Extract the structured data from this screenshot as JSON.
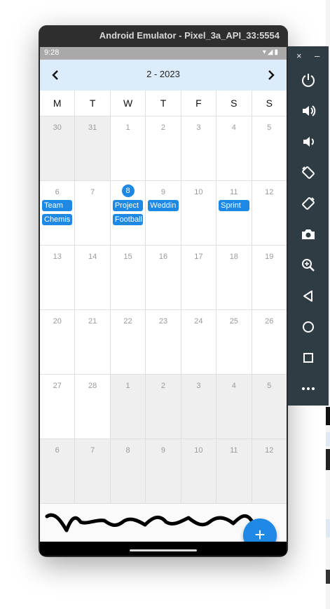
{
  "window": {
    "title": "Android Emulator - Pixel_3a_API_33:5554"
  },
  "status_bar": {
    "time": "9:28",
    "icons": "▾◢▮"
  },
  "calendar": {
    "title": "2 - 2023",
    "weekdays": [
      "M",
      "T",
      "W",
      "T",
      "F",
      "S",
      "S"
    ],
    "weeks": [
      [
        {
          "day": "30",
          "muted": true
        },
        {
          "day": "31",
          "muted": true
        },
        {
          "day": "1"
        },
        {
          "day": "2"
        },
        {
          "day": "3"
        },
        {
          "day": "4"
        },
        {
          "day": "5"
        }
      ],
      [
        {
          "day": "6",
          "events": [
            "Team",
            "Chemis"
          ]
        },
        {
          "day": "7"
        },
        {
          "day": "8",
          "today": true,
          "events": [
            "Project",
            "Football"
          ]
        },
        {
          "day": "9",
          "events": [
            "Weddin"
          ]
        },
        {
          "day": "10"
        },
        {
          "day": "11",
          "events": [
            "Sprint"
          ]
        },
        {
          "day": "12"
        }
      ],
      [
        {
          "day": "13"
        },
        {
          "day": "14"
        },
        {
          "day": "15"
        },
        {
          "day": "16"
        },
        {
          "day": "17"
        },
        {
          "day": "18"
        },
        {
          "day": "19"
        }
      ],
      [
        {
          "day": "20"
        },
        {
          "day": "21"
        },
        {
          "day": "22"
        },
        {
          "day": "23"
        },
        {
          "day": "24"
        },
        {
          "day": "25"
        },
        {
          "day": "26"
        }
      ],
      [
        {
          "day": "27"
        },
        {
          "day": "28"
        },
        {
          "day": "1",
          "muted": true
        },
        {
          "day": "2",
          "muted": true
        },
        {
          "day": "3",
          "muted": true
        },
        {
          "day": "4",
          "muted": true
        },
        {
          "day": "5",
          "muted": true
        }
      ],
      [
        {
          "day": "6",
          "muted": true
        },
        {
          "day": "7",
          "muted": true
        },
        {
          "day": "8",
          "muted": true
        },
        {
          "day": "9",
          "muted": true
        },
        {
          "day": "10",
          "muted": true
        },
        {
          "day": "11",
          "muted": true
        },
        {
          "day": "12",
          "muted": true
        }
      ]
    ]
  },
  "fab": {
    "label": "+"
  },
  "toolbar": {
    "close_label": "×",
    "minimize_label": "–",
    "buttons": [
      "power-icon",
      "volume-up-icon",
      "volume-down-icon",
      "rotate-left-icon",
      "rotate-right-icon",
      "camera-icon",
      "zoom-icon",
      "back-icon",
      "home-icon",
      "overview-icon",
      "more-icon"
    ]
  },
  "colors": {
    "accent": "#1e88e5",
    "header_bg": "#dcecfb",
    "toolbar_bg": "#2f3c44"
  }
}
